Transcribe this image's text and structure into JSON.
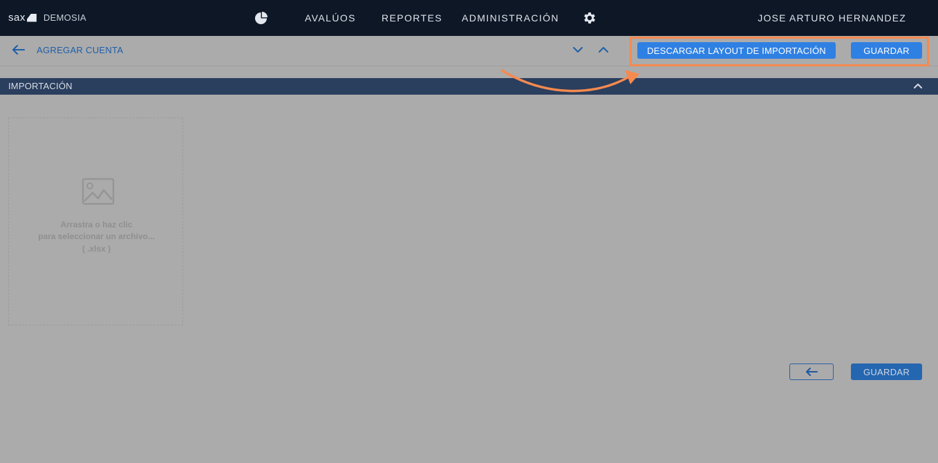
{
  "header": {
    "brand_logo": "sax",
    "brand_name": "DEMOSIA",
    "nav": [
      "AVALÚOS",
      "REPORTES",
      "ADMINISTRACIÓN"
    ],
    "user": "JOSE ARTURO HERNANDEZ"
  },
  "toolbar": {
    "back_label": "AGREGAR CUENTA",
    "download_layout_label": "DESCARGAR LAYOUT DE IMPORTACIÓN",
    "save_label": "GUARDAR"
  },
  "section": {
    "title": "IMPORTACIÓN"
  },
  "dropzone": {
    "line1": "Arrastra o haz clic",
    "line2": "para seleccionar un archivo...",
    "line3": "( .xlsx )"
  },
  "footer": {
    "save_label": "GUARDAR"
  },
  "colors": {
    "nav_bg": "#0e1726",
    "primary": "#2f80e3",
    "section_bar": "#2a3e5e",
    "highlight": "#f58a4f",
    "overlay_bg": "#ababab"
  },
  "icons": [
    "pie-chart-icon",
    "gear-icon",
    "arrow-left-icon",
    "chevron-down-icon",
    "chevron-up-icon",
    "image-icon"
  ]
}
